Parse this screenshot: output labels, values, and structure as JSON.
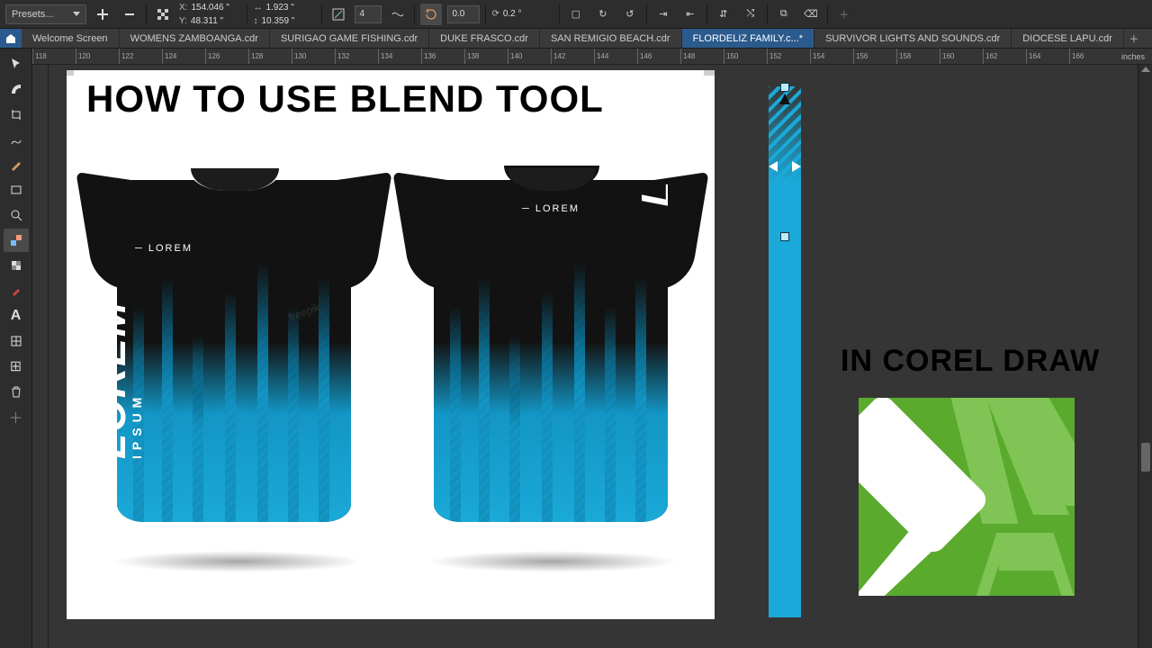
{
  "propertyBar": {
    "presetsLabel": "Presets...",
    "coords": {
      "x": "154.046 \"",
      "y": "48.311 \""
    },
    "size": {
      "w": "1.923 \"",
      "h": "10.359 \""
    },
    "steps": "4",
    "offset": "0.0",
    "rotation": "0.2 °"
  },
  "tabs": [
    {
      "label": "Welcome Screen",
      "active": false
    },
    {
      "label": "WOMENS ZAMBOANGA.cdr",
      "active": false
    },
    {
      "label": "SURIGAO GAME FISHING.cdr",
      "active": false
    },
    {
      "label": "DUKE FRASCO.cdr",
      "active": false
    },
    {
      "label": "SAN REMIGIO BEACH.cdr",
      "active": false
    },
    {
      "label": "FLORDELIZ FAMILY.c...*",
      "active": true
    },
    {
      "label": "SURVIVOR LIGHTS AND SOUNDS.cdr",
      "active": false
    },
    {
      "label": "DIOCESE LAPU.cdr",
      "active": false
    }
  ],
  "ruler": {
    "units": "inches",
    "ticks": [
      118,
      120,
      122,
      124,
      126,
      128,
      130,
      132,
      134,
      136,
      138,
      140,
      142,
      144,
      146,
      148,
      150,
      152,
      154,
      156,
      158,
      160,
      162,
      164,
      166
    ]
  },
  "canvas": {
    "title": "HOW TO USE BLEND TOOL",
    "subtitle": "IN COREL DRAW",
    "shirtBrand": "LOREM",
    "shirtBrandSmall": "LOREM",
    "shirtIpsum": "IPSUM",
    "watermark": "freepik"
  }
}
